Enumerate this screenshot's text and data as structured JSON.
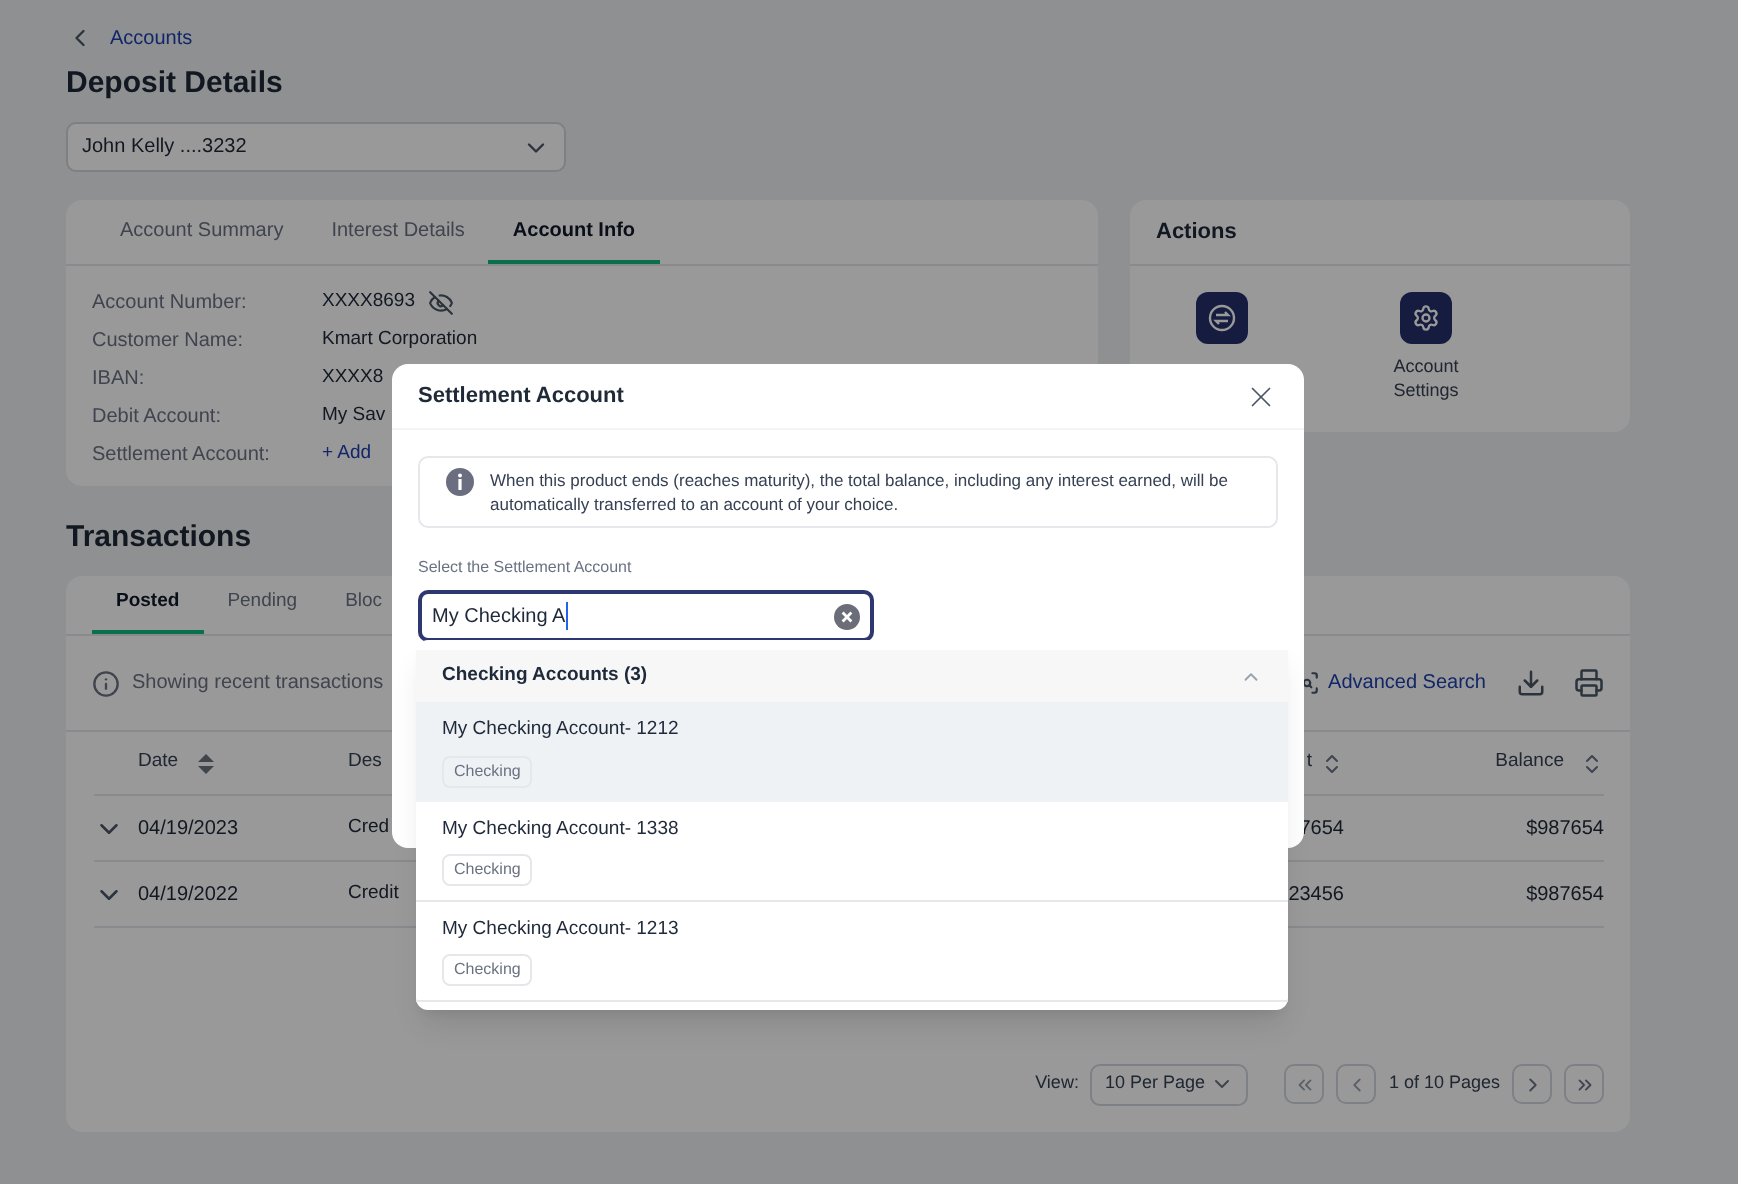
{
  "breadcrumb": {
    "label": "Accounts"
  },
  "page_title": "Deposit Details",
  "account_select": {
    "value": "John Kelly ....3232"
  },
  "account_card": {
    "tabs": [
      {
        "label": "Account Summary",
        "selected": false
      },
      {
        "label": "Interest Details",
        "selected": false
      },
      {
        "label": "Account Info",
        "selected": true
      }
    ],
    "fields": [
      {
        "label": "Account Number:",
        "value": "XXXX8693",
        "kind": "masked"
      },
      {
        "label": "Customer Name:",
        "value": "Kmart Corporation",
        "kind": "text"
      },
      {
        "label": "IBAN:",
        "value": "XXXX8",
        "kind": "text"
      },
      {
        "label": "Debit Account:",
        "value": "My Sav",
        "kind": "text"
      },
      {
        "label": "Settlement Account:",
        "value": "+ Add",
        "kind": "link"
      }
    ]
  },
  "actions": {
    "title": "Actions",
    "settings_label": "Account Settings"
  },
  "transactions": {
    "title": "Transactions",
    "tabs": [
      {
        "label": "Posted",
        "selected": true
      },
      {
        "label": "Pending",
        "selected": false
      },
      {
        "label": "Bloc",
        "selected": false
      }
    ],
    "info_text": "Showing recent transactions",
    "advanced_search": "Advanced Search",
    "columns": [
      {
        "label": "Date",
        "sorted": true
      },
      {
        "label": "Des"
      },
      {
        "label": "t",
        "sorted": false
      },
      {
        "label": "Balance",
        "sorted": false
      }
    ],
    "rows": [
      {
        "date": "04/19/2023",
        "description": "Cred",
        "amount": "7654",
        "balance": "$987654"
      },
      {
        "date": "04/19/2022",
        "description": "Credit",
        "amount": "23456",
        "balance": "$987654"
      }
    ],
    "pagination": {
      "view_label": "View:",
      "per_page": "10 Per Page",
      "page_info": "1 of 10 Pages"
    }
  },
  "modal": {
    "title": "Settlement Account",
    "info": "When this product ends (reaches maturity), the total balance, including any interest earned, will be automatically transferred to an account of your choice.",
    "field_label": "Select the Settlement Account",
    "search_value": "My Checking A",
    "dropdown": {
      "group_title": "Checking Accounts (3)",
      "expanded": true,
      "options": [
        {
          "name": "My Checking Account- 1212",
          "tag": "Checking",
          "selected": true
        },
        {
          "name": "My Checking Account- 1338",
          "tag": "Checking",
          "selected": false
        },
        {
          "name": "My Checking Account- 1213",
          "tag": "Checking",
          "selected": false
        }
      ]
    }
  }
}
